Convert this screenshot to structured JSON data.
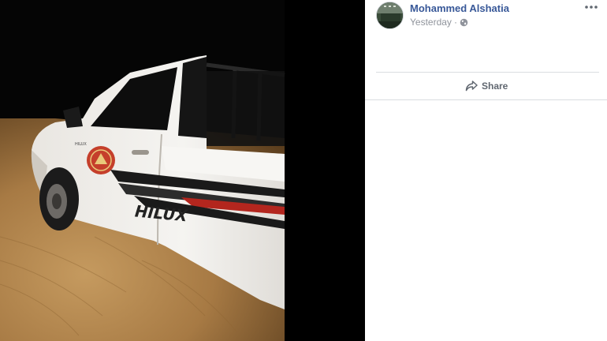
{
  "post": {
    "author_name": "Mohammed Alshatia",
    "timestamp": "Yesterday",
    "separator": "·",
    "privacy_icon": "globe-icon",
    "more_icon": "more-options-icon",
    "share_label": "Share",
    "share_icon": "share-arrow-icon"
  },
  "photo": {
    "truck_badge_text": "HILUX",
    "logo_text": "HILUX"
  },
  "colors": {
    "author_link": "#385898",
    "meta_text": "#90949c",
    "action_text": "#606770",
    "divider": "#dadde1",
    "background_photo": "#000000"
  }
}
